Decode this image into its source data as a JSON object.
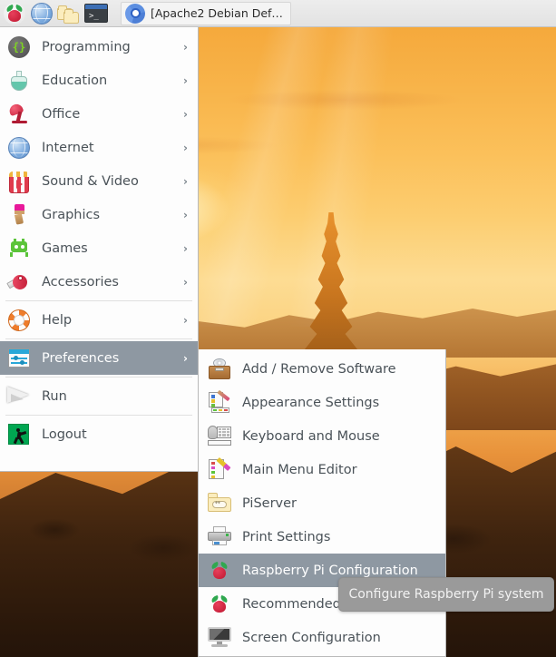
{
  "taskbar": {
    "launchers": [
      {
        "name": "raspberry-pi-menu-icon",
        "label": "Raspberry Pi Menu"
      },
      {
        "name": "web-browser-icon",
        "label": "Web Browser"
      },
      {
        "name": "file-manager-icon",
        "label": "File Manager"
      },
      {
        "name": "terminal-icon",
        "label": "Terminal"
      }
    ],
    "window_button": {
      "icon": "chromium-icon",
      "title": "[Apache2 Debian Def…"
    }
  },
  "main_menu": {
    "items": [
      {
        "label": "Programming",
        "icon": "programming-icon",
        "arrow": "›",
        "selected": false,
        "separator_after": false
      },
      {
        "label": "Education",
        "icon": "education-icon",
        "arrow": "›",
        "selected": false,
        "separator_after": false
      },
      {
        "label": "Office",
        "icon": "office-icon",
        "arrow": "›",
        "selected": false,
        "separator_after": false
      },
      {
        "label": "Internet",
        "icon": "internet-icon",
        "arrow": "›",
        "selected": false,
        "separator_after": false
      },
      {
        "label": "Sound & Video",
        "icon": "sound-video-icon",
        "arrow": "›",
        "selected": false,
        "separator_after": false
      },
      {
        "label": "Graphics",
        "icon": "graphics-icon",
        "arrow": "›",
        "selected": false,
        "separator_after": false
      },
      {
        "label": "Games",
        "icon": "games-icon",
        "arrow": "›",
        "selected": false,
        "separator_after": false
      },
      {
        "label": "Accessories",
        "icon": "accessories-icon",
        "arrow": "›",
        "selected": false,
        "separator_after": true
      },
      {
        "label": "Help",
        "icon": "help-icon",
        "arrow": "›",
        "selected": false,
        "separator_after": true
      },
      {
        "label": "Preferences",
        "icon": "preferences-icon",
        "arrow": "›",
        "selected": true,
        "separator_after": true
      },
      {
        "label": "Run",
        "icon": "run-icon",
        "arrow": "",
        "selected": false,
        "separator_after": true
      },
      {
        "label": "Logout",
        "icon": "logout-icon",
        "arrow": "",
        "selected": false,
        "separator_after": false
      }
    ]
  },
  "submenu": {
    "parent": "Preferences",
    "items": [
      {
        "label": "Add / Remove Software",
        "icon": "add-remove-software-icon",
        "selected": false
      },
      {
        "label": "Appearance Settings",
        "icon": "appearance-settings-icon",
        "selected": false
      },
      {
        "label": "Keyboard and Mouse",
        "icon": "keyboard-mouse-icon",
        "selected": false
      },
      {
        "label": "Main Menu Editor",
        "icon": "main-menu-editor-icon",
        "selected": false
      },
      {
        "label": "PiServer",
        "icon": "piserver-icon",
        "selected": false
      },
      {
        "label": "Print Settings",
        "icon": "print-settings-icon",
        "selected": false
      },
      {
        "label": "Raspberry Pi Configuration",
        "icon": "raspberry-pi-icon",
        "selected": true
      },
      {
        "label": "Recommended Software",
        "icon": "raspberry-pi-icon",
        "selected": false
      },
      {
        "label": "Screen Configuration",
        "icon": "screen-configuration-icon",
        "selected": false
      }
    ]
  },
  "tooltip": {
    "text": "Configure Raspberry Pi system"
  },
  "colors": {
    "highlight": "#8e98a2",
    "menu_background": "#fdfdfd",
    "menu_text": "#4a5258",
    "taskbar_background": "#e6e6e6",
    "tooltip_background": "#9a9a9a"
  },
  "terminal_prompt": ">_"
}
